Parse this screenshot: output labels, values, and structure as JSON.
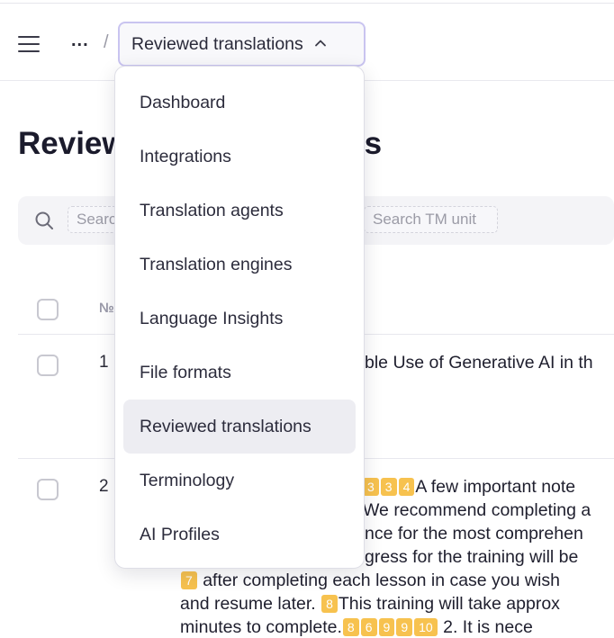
{
  "header": {
    "ellipsis": "...",
    "separator": "/",
    "current": "Reviewed translations"
  },
  "menu": {
    "items": [
      {
        "label": "Dashboard"
      },
      {
        "label": "Integrations"
      },
      {
        "label": "Translation agents"
      },
      {
        "label": "Translation engines"
      },
      {
        "label": "Language Insights"
      },
      {
        "label": "File formats"
      },
      {
        "label": "Reviewed translations",
        "active": true
      },
      {
        "label": "Terminology"
      },
      {
        "label": "AI Profiles"
      }
    ]
  },
  "page": {
    "title_left": "Review",
    "title_right": "s"
  },
  "search": {
    "chip1": "Searc",
    "chip2": "Search TM unit"
  },
  "table": {
    "col_number": "№",
    "rows": [
      {
        "number": "1",
        "text": "ble Use of Generative AI in th"
      },
      {
        "number": "2"
      }
    ]
  },
  "segment": {
    "tag_3a": "3",
    "tag_3b": "3",
    "tag_4": "4",
    "line1_text": "A few important note",
    "line2_text": "We recommend completing a",
    "line3_text": "nce for the most comprehen",
    "line4_text": "gress for the training will be",
    "tag_7": "7",
    "line5_text": " after completing each lesson in case you wish",
    "line6_text": "and resume later. ",
    "tag_8a": "8",
    "line6_text2": "This training will take approx",
    "line7_text": "minutes to complete.",
    "tag_8b": "8",
    "tag_6": "6",
    "tag_9a": "9",
    "tag_9b": "9",
    "tag_10": "10",
    "line7_text2": " 2. It is nece"
  },
  "colors": {
    "accent_border": "#c9c4f0",
    "tag": "#f7c24f",
    "active_item": "#ededf2"
  }
}
